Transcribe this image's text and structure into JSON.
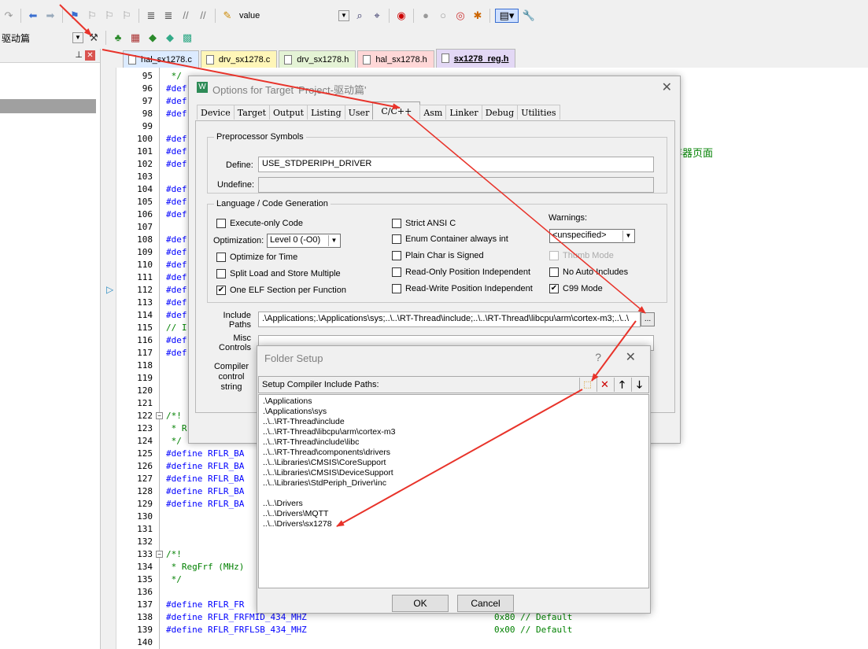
{
  "toolbar": {
    "target_value": "value",
    "target_name": "驱动篇"
  },
  "tabs": [
    {
      "label": "hal_sx1278.c",
      "color": "#dcebff",
      "active": false
    },
    {
      "label": "drv_sx1278.c",
      "color": "#fff6b8",
      "active": false
    },
    {
      "label": "drv_sx1278.h",
      "color": "#e4f3d5",
      "active": false
    },
    {
      "label": "hal_sx1278.h",
      "color": "#ffd7d7",
      "active": false
    },
    {
      "label": "sx1278_reg.h",
      "color": "#e3d8f5",
      "active": true
    }
  ],
  "editor": {
    "lines": [
      {
        "n": "95",
        "t": " */"
      },
      {
        "n": "96",
        "t": "#def"
      },
      {
        "n": "97",
        "t": "#def"
      },
      {
        "n": "98",
        "t": "#def"
      },
      {
        "n": "99",
        "t": ""
      },
      {
        "n": "100",
        "t": "#def"
      },
      {
        "n": "101",
        "t": "#def"
      },
      {
        "n": "102",
        "t": "#def"
      },
      {
        "n": "103",
        "t": ""
      },
      {
        "n": "104",
        "t": "#def"
      },
      {
        "n": "105",
        "t": "#def"
      },
      {
        "n": "106",
        "t": "#def"
      },
      {
        "n": "107",
        "t": ""
      },
      {
        "n": "108",
        "t": "#def"
      },
      {
        "n": "109",
        "t": "#def"
      },
      {
        "n": "110",
        "t": "#def"
      },
      {
        "n": "111",
        "t": "#def"
      },
      {
        "n": "112",
        "t": "#def"
      },
      {
        "n": "113",
        "t": "#def"
      },
      {
        "n": "114",
        "t": "#def"
      },
      {
        "n": "115",
        "t": "// I"
      },
      {
        "n": "116",
        "t": "#def"
      },
      {
        "n": "117",
        "t": "#def"
      },
      {
        "n": "118",
        "t": ""
      },
      {
        "n": "119",
        "t": ""
      },
      {
        "n": "120",
        "t": ""
      },
      {
        "n": "121",
        "t": ""
      },
      {
        "n": "122",
        "t": "/*!"
      },
      {
        "n": "123",
        "t": " * R"
      },
      {
        "n": "124",
        "t": " */"
      },
      {
        "n": "125",
        "t": "#define RFLR_BA"
      },
      {
        "n": "126",
        "t": "#define RFLR_BA"
      },
      {
        "n": "127",
        "t": "#define RFLR_BA"
      },
      {
        "n": "128",
        "t": "#define RFLR_BA"
      },
      {
        "n": "129",
        "t": "#define RFLR_BA"
      },
      {
        "n": "130",
        "t": ""
      },
      {
        "n": "131",
        "t": ""
      },
      {
        "n": "132",
        "t": ""
      },
      {
        "n": "133",
        "t": "/*!"
      },
      {
        "n": "134",
        "t": " * RegFrf (MHz)"
      },
      {
        "n": "135",
        "t": " */"
      },
      {
        "n": "136",
        "t": ""
      },
      {
        "n": "137",
        "t": "#define RFLR_FR"
      },
      {
        "n": "138",
        "t": "#define RFLR_FRFMID_434_MHZ"
      },
      {
        "n": "139",
        "t": "#define RFLR_FRFLSB_434_MHZ"
      },
      {
        "n": "140",
        "t": ""
      }
    ],
    "right_comment": "存器页面",
    "line138_value": "0x80 // Default",
    "line139_value": "0x00 // Default"
  },
  "options_dialog": {
    "title": "Options for Target 'Project-驱动篇'",
    "tabs": [
      "Device",
      "Target",
      "Output",
      "Listing",
      "User",
      "C/C++",
      "Asm",
      "Linker",
      "Debug",
      "Utilities"
    ],
    "active_tab": "C/C++",
    "preprocessor": {
      "legend": "Preprocessor Symbols",
      "define_label": "Define:",
      "define_value": "USE_STDPERIPH_DRIVER",
      "undefine_label": "Undefine:",
      "undefine_value": ""
    },
    "language": {
      "legend": "Language / Code Generation",
      "execute_only": "Execute-only Code",
      "optimization_label": "Optimization:",
      "optimization_value": "Level 0 (-O0)",
      "optimize_time": "Optimize for Time",
      "split_load": "Split Load and Store Multiple",
      "one_elf": "One ELF Section per Function",
      "strict_ansi": "Strict ANSI C",
      "enum_container": "Enum Container always int",
      "plain_char": "Plain Char is Signed",
      "ropi": "Read-Only Position Independent",
      "rwpi": "Read-Write Position Independent",
      "warnings_label": "Warnings:",
      "warnings_value": "<unspecified>",
      "thumb_mode": "Thumb Mode",
      "no_auto_includes": "No Auto Includes",
      "c99_mode": "C99 Mode"
    },
    "include_paths_label": "Include Paths",
    "include_paths_value": ".\\Applications;.\\Applications\\sys;..\\..\\RT-Thread\\include;..\\..\\RT-Thread\\libcpu\\arm\\cortex-m3;..\\..\\",
    "misc_controls_label": "Misc Controls",
    "compiler_control_label": "Compiler control string",
    "browse_label": "..."
  },
  "folder_dialog": {
    "title": "Folder Setup",
    "help": "?",
    "subtitle": "Setup Compiler Include Paths:",
    "paths": [
      ".\\Applications",
      ".\\Applications\\sys",
      "..\\..\\RT-Thread\\include",
      "..\\..\\RT-Thread\\libcpu\\arm\\cortex-m3",
      "..\\..\\RT-Thread\\include\\libc",
      "..\\..\\RT-Thread\\components\\drivers",
      "..\\..\\Libraries\\CMSIS\\CoreSupport",
      "..\\..\\Libraries\\CMSIS\\DeviceSupport",
      "..\\..\\Libraries\\StdPeriph_Driver\\inc",
      "",
      "..\\..\\Drivers",
      "..\\..\\Drivers\\MQTT",
      "..\\..\\Drivers\\sx1278"
    ],
    "ok_label": "OK",
    "cancel_label": "Cancel"
  },
  "colors": {
    "annotation_arrow": "#e8332a",
    "keyword": "#0000ff",
    "comment": "#008000"
  }
}
